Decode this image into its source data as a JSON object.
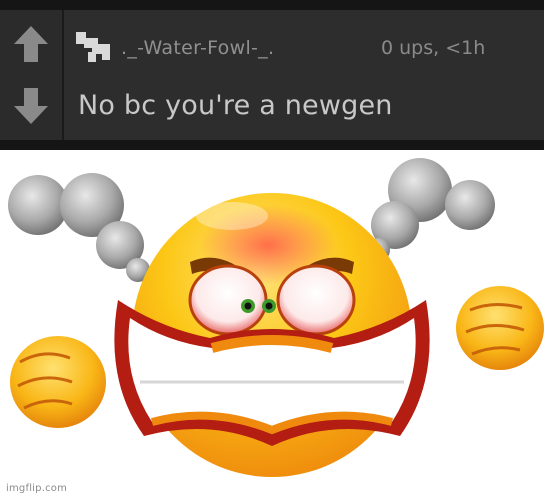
{
  "comment": {
    "username": "._-Water-Fowl-_.",
    "meta": "0 ups, <1h",
    "text": "No bc you're a newgen"
  },
  "icons": {
    "upvote": "arrow-up-icon",
    "downvote": "arrow-down-icon",
    "user": "user-badge-icon"
  },
  "image": {
    "subject": "angry-emoji",
    "watermark": "imgflip.com"
  },
  "colors": {
    "panel_bg": "#2d2d2d",
    "emoji_yellow": "#fcc716",
    "emoji_orange": "#f08a0e",
    "anger_red": "#e8322a"
  }
}
